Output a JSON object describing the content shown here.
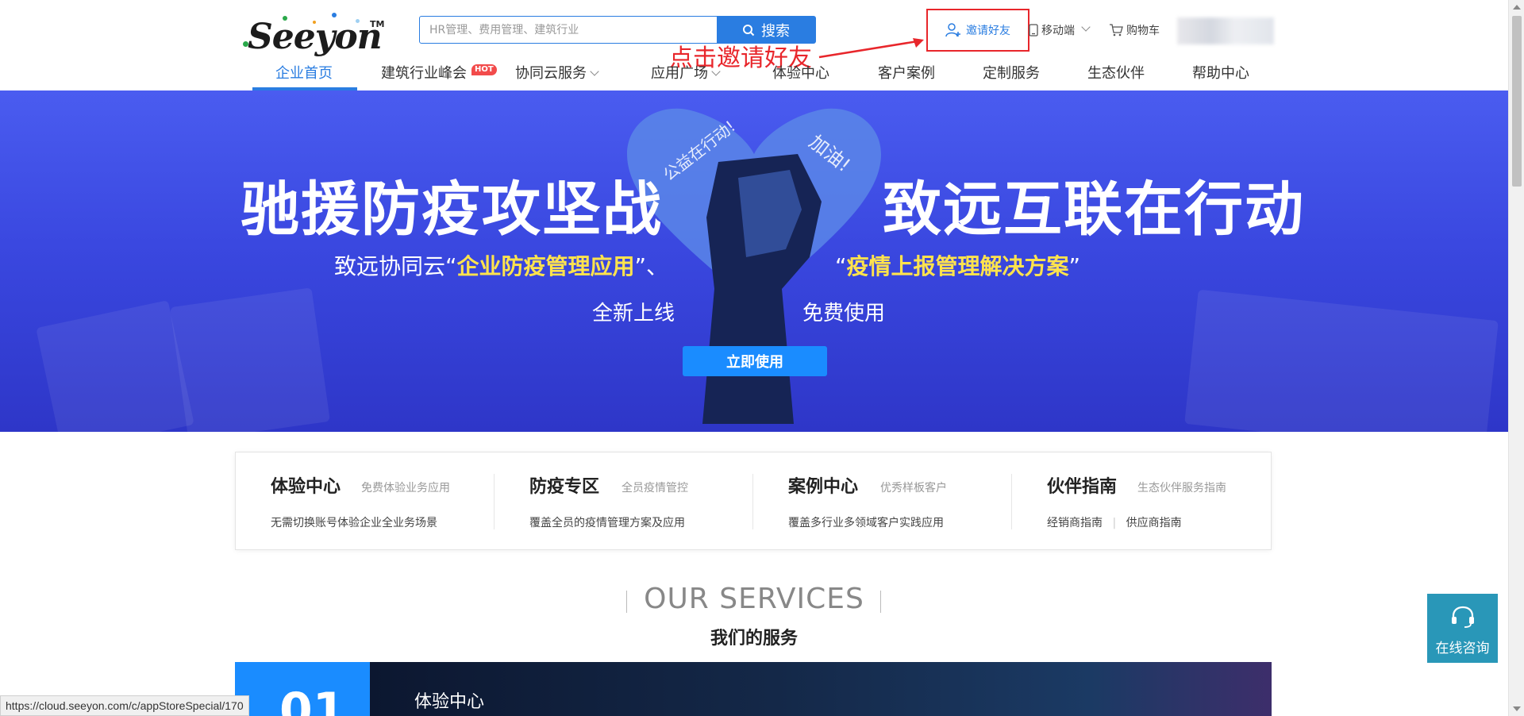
{
  "header": {
    "logo_text": "Seeyon",
    "logo_tm": "TM",
    "search": {
      "placeholder": "HR管理、费用管理、建筑行业",
      "button_label": "搜索"
    },
    "invite_label": "邀请好友",
    "mobile_label": "移动端",
    "cart_label": "购物车",
    "annotation": "点击邀请好友"
  },
  "nav": {
    "items": [
      {
        "label": "企业首页",
        "active": true
      },
      {
        "label": "建筑行业峰会",
        "badge": "HOT"
      },
      {
        "label": "协同云服务",
        "has_dropdown": true
      },
      {
        "label": "应用广场",
        "has_dropdown": true
      },
      {
        "label": "体验中心"
      },
      {
        "label": "客户案例"
      },
      {
        "label": "定制服务"
      },
      {
        "label": "生态伙伴"
      },
      {
        "label": "帮助中心"
      }
    ]
  },
  "banner": {
    "title_left": "驰援防疫攻坚战",
    "title_right": "致远互联在行动",
    "heart_left": "公益在行动!",
    "heart_right": "加油!",
    "subtitle_prefix": "致远协同云“",
    "highlight_1": "企业防疫管理应用",
    "subtitle_mid": "”、",
    "subtitle_quote_open": "“",
    "highlight_2": "疫情上报管理解决方案",
    "subtitle_suffix": "”",
    "line3_left": "全新上线",
    "line3_right": "免费使用",
    "cta_label": "立即使用"
  },
  "cards": [
    {
      "title": "体验中心",
      "subtitle": "免费体验业务应用",
      "desc": "无需切换账号体验企业全业务场景"
    },
    {
      "title": "防疫专区",
      "subtitle": "全员疫情管控",
      "desc": "覆盖全员的疫情管理方案及应用"
    },
    {
      "title": "案例中心",
      "subtitle": "优秀样板客户",
      "desc": "覆盖多行业多领域客户实践应用"
    },
    {
      "title": "伙伴指南",
      "subtitle": "生态伙伴服务指南",
      "desc_a": "经销商指南",
      "desc_b": "供应商指南"
    }
  ],
  "services": {
    "title_en": "OUR SERVICES",
    "title_cn": "我们的服务",
    "first_num": "01",
    "first_label": "体验中心"
  },
  "status_url": "https://cloud.seeyon.com/c/appStoreSpecial/170",
  "consult_label": "在线咨询",
  "colors": {
    "accent": "#2a7de1",
    "banner": "#3a48e0",
    "highlight": "#ffe34d",
    "annotation": "#e8262b",
    "consult": "#2997b8"
  }
}
